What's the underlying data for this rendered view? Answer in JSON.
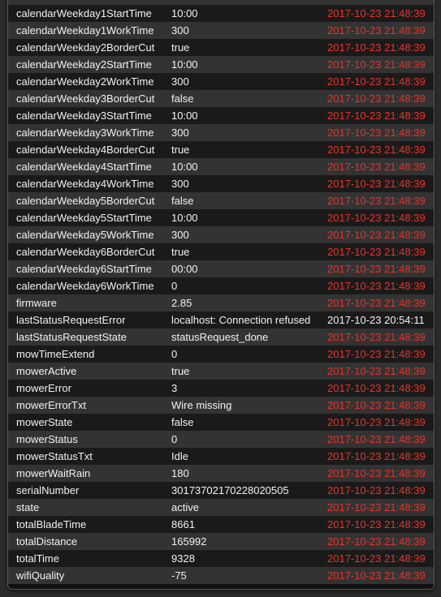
{
  "colors": {
    "stale_timestamp": "#e8352b",
    "fresh_timestamp": "#f2f2f2",
    "row_dark": "#1a1a1a",
    "row_light": "#333333"
  },
  "readings": [
    {
      "name": "calendarWeekday1StartTime",
      "value": "10:00",
      "time": "2017-10-23 21:48:39",
      "stale": true
    },
    {
      "name": "calendarWeekday1WorkTime",
      "value": "300",
      "time": "2017-10-23 21:48:39",
      "stale": true
    },
    {
      "name": "calendarWeekday2BorderCut",
      "value": "true",
      "time": "2017-10-23 21:48:39",
      "stale": true
    },
    {
      "name": "calendarWeekday2StartTime",
      "value": "10:00",
      "time": "2017-10-23 21:48:39",
      "stale": true
    },
    {
      "name": "calendarWeekday2WorkTime",
      "value": "300",
      "time": "2017-10-23 21:48:39",
      "stale": true
    },
    {
      "name": "calendarWeekday3BorderCut",
      "value": "false",
      "time": "2017-10-23 21:48:39",
      "stale": true
    },
    {
      "name": "calendarWeekday3StartTime",
      "value": "10:00",
      "time": "2017-10-23 21:48:39",
      "stale": true
    },
    {
      "name": "calendarWeekday3WorkTime",
      "value": "300",
      "time": "2017-10-23 21:48:39",
      "stale": true
    },
    {
      "name": "calendarWeekday4BorderCut",
      "value": "true",
      "time": "2017-10-23 21:48:39",
      "stale": true
    },
    {
      "name": "calendarWeekday4StartTime",
      "value": "10:00",
      "time": "2017-10-23 21:48:39",
      "stale": true
    },
    {
      "name": "calendarWeekday4WorkTime",
      "value": "300",
      "time": "2017-10-23 21:48:39",
      "stale": true
    },
    {
      "name": "calendarWeekday5BorderCut",
      "value": "false",
      "time": "2017-10-23 21:48:39",
      "stale": true
    },
    {
      "name": "calendarWeekday5StartTime",
      "value": "10:00",
      "time": "2017-10-23 21:48:39",
      "stale": true
    },
    {
      "name": "calendarWeekday5WorkTime",
      "value": "300",
      "time": "2017-10-23 21:48:39",
      "stale": true
    },
    {
      "name": "calendarWeekday6BorderCut",
      "value": "true",
      "time": "2017-10-23 21:48:39",
      "stale": true
    },
    {
      "name": "calendarWeekday6StartTime",
      "value": "00:00",
      "time": "2017-10-23 21:48:39",
      "stale": true
    },
    {
      "name": "calendarWeekday6WorkTime",
      "value": "0",
      "time": "2017-10-23 21:48:39",
      "stale": true
    },
    {
      "name": "firmware",
      "value": "2.85",
      "time": "2017-10-23 21:48:39",
      "stale": true
    },
    {
      "name": "lastStatusRequestError",
      "value": "localhost: Connection refused",
      "time": "2017-10-23 20:54:11",
      "stale": false
    },
    {
      "name": "lastStatusRequestState",
      "value": "statusRequest_done",
      "time": "2017-10-23 21:48:39",
      "stale": true
    },
    {
      "name": "mowTimeExtend",
      "value": "0",
      "time": "2017-10-23 21:48:39",
      "stale": true
    },
    {
      "name": "mowerActive",
      "value": "true",
      "time": "2017-10-23 21:48:39",
      "stale": true
    },
    {
      "name": "mowerError",
      "value": "3",
      "time": "2017-10-23 21:48:39",
      "stale": true
    },
    {
      "name": "mowerErrorTxt",
      "value": "Wire missing",
      "time": "2017-10-23 21:48:39",
      "stale": true
    },
    {
      "name": "mowerState",
      "value": "false",
      "time": "2017-10-23 21:48:39",
      "stale": true
    },
    {
      "name": "mowerStatus",
      "value": "0",
      "time": "2017-10-23 21:48:39",
      "stale": true
    },
    {
      "name": "mowerStatusTxt",
      "value": "Idle",
      "time": "2017-10-23 21:48:39",
      "stale": true
    },
    {
      "name": "mowerWaitRain",
      "value": "180",
      "time": "2017-10-23 21:48:39",
      "stale": true
    },
    {
      "name": "serialNumber",
      "value": "30173702170228020505",
      "time": "2017-10-23 21:48:39",
      "stale": true
    },
    {
      "name": "state",
      "value": "active",
      "time": "2017-10-23 21:48:39",
      "stale": true
    },
    {
      "name": "totalBladeTime",
      "value": "8661",
      "time": "2017-10-23 21:48:39",
      "stale": true
    },
    {
      "name": "totalDistance",
      "value": "165992",
      "time": "2017-10-23 21:48:39",
      "stale": true
    },
    {
      "name": "totalTime",
      "value": "9328",
      "time": "2017-10-23 21:48:39",
      "stale": true
    },
    {
      "name": "wifiQuality",
      "value": "-75",
      "time": "2017-10-23 21:48:39",
      "stale": true
    }
  ]
}
